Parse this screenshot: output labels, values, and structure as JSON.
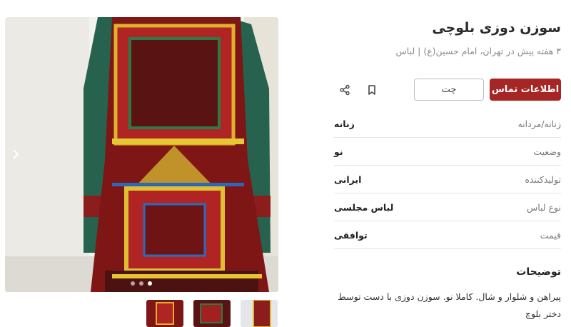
{
  "listing": {
    "title": "سوزن دوزی بلوچی",
    "subtitle": "۳ هفته پیش در تهران، امام حسین(ع) | لباس"
  },
  "actions": {
    "contact_label": "اطلاعات تماس",
    "chat_label": "چت",
    "bookmark_icon": "bookmark-icon",
    "share_icon": "share-icon"
  },
  "details": [
    {
      "label": "زنانه/مردانه",
      "value": "زنانه"
    },
    {
      "label": "وضعیت",
      "value": "نو"
    },
    {
      "label": "تولیدکننده",
      "value": "ایرانی"
    },
    {
      "label": "نوع لباس",
      "value": "لباس مجلسی"
    },
    {
      "label": "قیمت",
      "value": "توافقی"
    }
  ],
  "description": {
    "title": "توضیحات",
    "text": "پیراهن و شلوار و شال. کاملا نو. سوزن دوزی با دست توسط دختر بلوچ"
  },
  "gallery": {
    "image_alt": "Balochi embroidered dress",
    "dots": 3,
    "active_dot": 3,
    "next_icon": "chevron-right-icon",
    "thumbnail_count": 3
  },
  "colors": {
    "accent": "#a62626"
  }
}
